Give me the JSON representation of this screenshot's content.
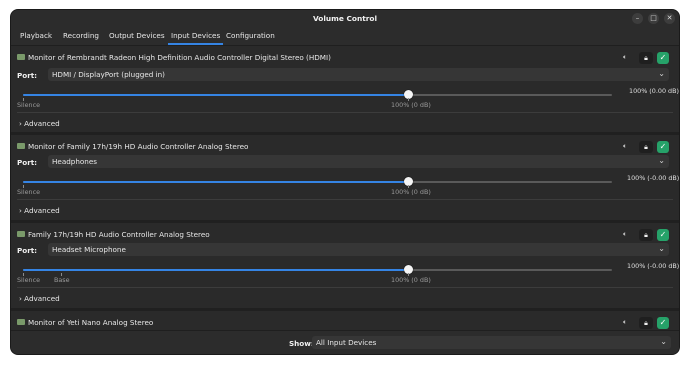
{
  "window": {
    "title": "Volume Control"
  },
  "tabs": [
    {
      "label": "Playback",
      "active": false
    },
    {
      "label": "Recording",
      "active": false
    },
    {
      "label": "Output Devices",
      "active": false
    },
    {
      "label": "Input Devices",
      "active": true
    },
    {
      "label": "Configuration",
      "active": false
    }
  ],
  "devices": [
    {
      "name": "Monitor of Rembrandt Radeon High Definition Audio Controller Digital Stereo (HDMI)",
      "port_label": "Port:",
      "port_value": "HDMI / DisplayPort (plugged in)",
      "volume_label": "100% (0.00 dB)",
      "knob_label": "100% (0 dB)",
      "silence_label": "Silence",
      "advanced_label": "Advanced",
      "level": 1.0
    },
    {
      "name": "Monitor of Family 17h/19h HD Audio Controller Analog Stereo",
      "port_label": "Port:",
      "port_value": "Headphones",
      "volume_label": "100% (-0.00 dB)",
      "knob_label": "100% (0 dB)",
      "silence_label": "Silence",
      "advanced_label": "Advanced",
      "level": 1.0
    },
    {
      "name": "Family 17h/19h HD Audio Controller Analog Stereo",
      "port_label": "Port:",
      "port_value": "Headset Microphone",
      "volume_label": "100% (-0.00 dB)",
      "knob_label": "100% (0 dB)",
      "silence_label": "Silence",
      "base_label": "Base",
      "advanced_label": "Advanced",
      "level": 1.0
    },
    {
      "name": "Monitor of Yeti Nano Analog Stereo"
    }
  ],
  "footer": {
    "show_label": "Show:",
    "show_value": "All Input Devices"
  },
  "colors": {
    "accent": "#3584e4",
    "check": "#26a269"
  },
  "icons": {
    "minimize": "minimize-icon",
    "maximize": "maximize-icon",
    "close": "close-icon",
    "device": "microphone-device-icon",
    "speaker": "speaker-icon",
    "lock": "lock-icon",
    "check": "check-icon",
    "chevron": "chevron-down-icon"
  }
}
